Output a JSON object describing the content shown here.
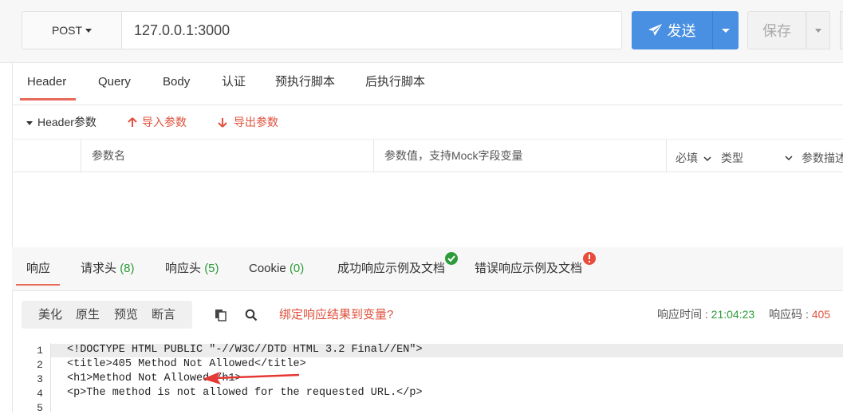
{
  "request": {
    "method": "POST",
    "url": "127.0.0.1:3000",
    "send_label": "发送",
    "save_label": "保存"
  },
  "tabs": [
    "Header",
    "Query",
    "Body",
    "认证",
    "预执行脚本",
    "后执行脚本"
  ],
  "params": {
    "section_label": "Header参数",
    "import_label": "导入参数",
    "export_label": "导出参数",
    "columns": {
      "name": "参数名",
      "value": "参数值，支持Mock字段变量",
      "required": "必填",
      "type": "类型",
      "desc": "参数描述"
    }
  },
  "response_tabs": {
    "response": "响应",
    "req_headers": "请求头",
    "req_headers_count": "(8)",
    "resp_headers": "响应头",
    "resp_headers_count": "(5)",
    "cookie": "Cookie",
    "cookie_count": "(0)",
    "success_doc": "成功响应示例及文档",
    "error_doc": "错误响应示例及文档"
  },
  "toolbar": {
    "pretty": "美化",
    "raw": "原生",
    "preview": "预览",
    "assert": "断言",
    "bind_link": "绑定响应结果到变量?",
    "time_label": "响应时间 :",
    "time_value": "21:04:23",
    "code_label": "响应码 :",
    "code_value": "405"
  },
  "code_lines": [
    {
      "n": "1",
      "text": "<!DOCTYPE HTML PUBLIC \"-//W3C//DTD HTML 3.2 Final//EN\">"
    },
    {
      "n": "2",
      "text": "<title>405 Method Not Allowed</title>"
    },
    {
      "n": "3",
      "text": "<h1>Method Not Allowed</h1>"
    },
    {
      "n": "4",
      "text": "<p>The method is not allowed for the requested URL.</p>"
    },
    {
      "n": "5",
      "text": ""
    }
  ],
  "colors": {
    "accent_red": "#e0513e",
    "send_blue": "#4a90e2",
    "success_green": "#2e9b3a",
    "error_red": "#e74c3c"
  }
}
